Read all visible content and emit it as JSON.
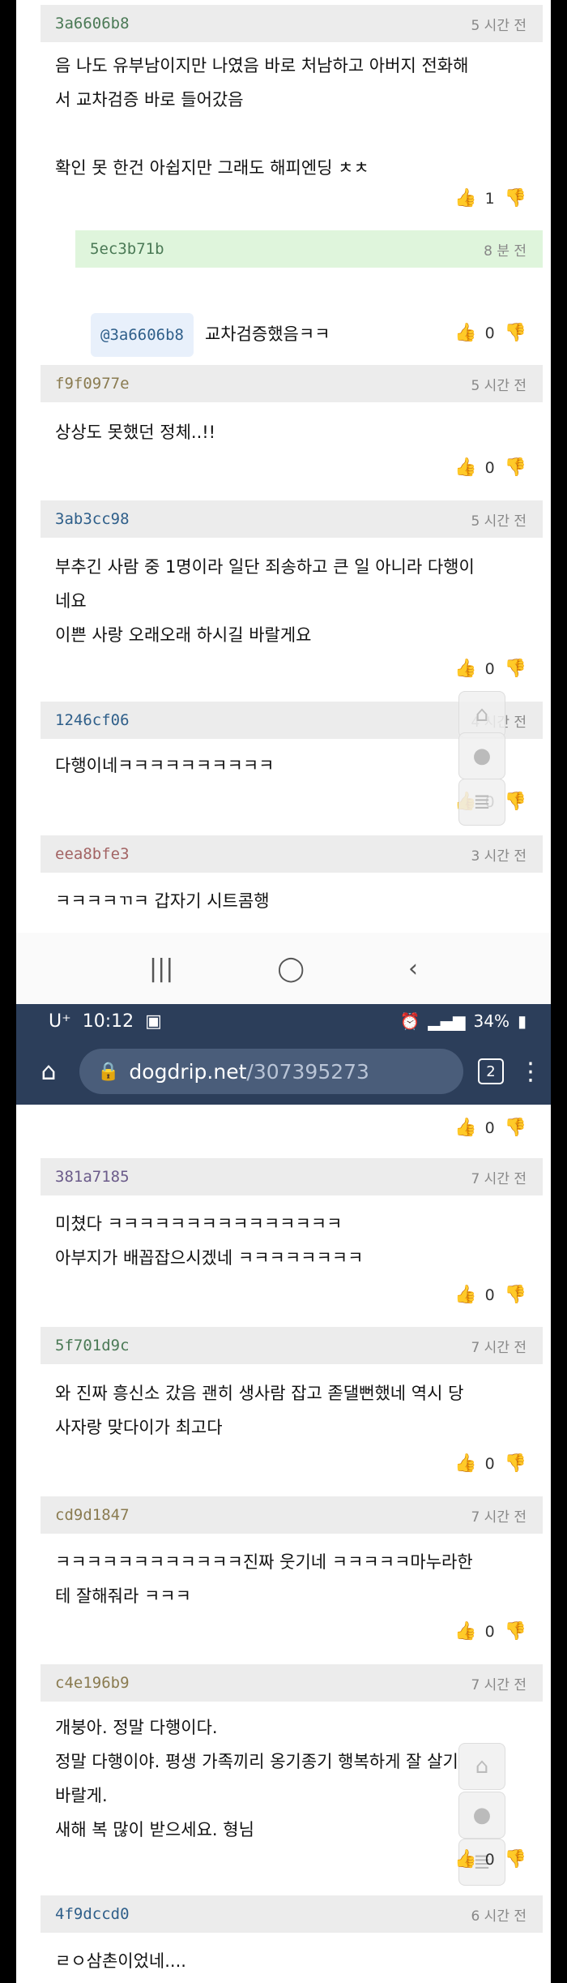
{
  "top_panel": {
    "comments": [
      {
        "id": "3a6606b8",
        "time": "5 시간 전",
        "text": "음 나도 유부남이지만 나였음 바로 처남하고 아버지 전화해\n서 교차검증 바로 들어갔음\n\n확인 못 한건 아쉽지만 그래도 해피엔딩 ㅊㅊ",
        "likes": "1"
      },
      {
        "id": "5ec3b71b",
        "time": "8 분 전",
        "mention": "@3a6606b8",
        "text": "교차검증했음ㅋㅋ",
        "likes": "0"
      },
      {
        "id": "f9f0977e",
        "time": "5 시간 전",
        "text": "상상도 못했던 정체..!!",
        "likes": "0"
      },
      {
        "id": "3ab3cc98",
        "time": "5 시간 전",
        "text": "부추긴 사람 중 1명이라 일단 죄송하고 큰 일 아니라 다행이\n네요\n이쁜 사랑 오래오래 하시길 바랄게요",
        "likes": "0"
      },
      {
        "id": "1246cf06",
        "time": "4 시간 전",
        "text": "다행이네ㅋㅋㅋㅋㅋㅋㅋㅋㅋㅋ",
        "likes": "0"
      },
      {
        "id": "eea8bfe3",
        "time": "3 시간 전",
        "text": "ㅋㅋㅋㅋㄲㅋ 갑자기 시트콤행"
      }
    ]
  },
  "navbar": {
    "recent_icon": "recent-apps-icon",
    "home_icon": "home-circle-icon",
    "back_icon": "back-chevron-icon"
  },
  "statusbar": {
    "carrier": "U⁺",
    "time": "10:12",
    "battery": "34%"
  },
  "urlbar": {
    "domain": "dogdrip.net",
    "path": "/307395273",
    "tab_count": "2"
  },
  "bottom_panel": {
    "top_likes": "0",
    "comments": [
      {
        "id": "381a7185",
        "time": "7 시간 전",
        "text": "미쳤다 ㅋㅋㅋㅋㅋㅋㅋㅋㅋㅋㅋㅋㅋㅋㅋ\n아부지가 배꼽잡으시겠네 ㅋㅋㅋㅋㅋㅋㅋㅋ",
        "likes": "0"
      },
      {
        "id": "5f701d9c",
        "time": "7 시간 전",
        "text": "와 진짜 흥신소 갔음 괜히 생사람 잡고 졷댈뻔했네 역시 당\n사자랑 맞다이가 최고다",
        "likes": "0"
      },
      {
        "id": "cd9d1847",
        "time": "7 시간 전",
        "text": "ㅋㅋㅋㅋㅋㅋㅋㅋㅋㅋㅋㅋ진짜 웃기네 ㅋㅋㅋㅋㅋ마누라한\n테 잘해줘라 ㅋㅋㅋ",
        "likes": "0"
      },
      {
        "id": "c4e196b9",
        "time": "7 시간 전",
        "text": "개붕아. 정말 다행이다.\n정말 다행이야. 평생 가족끼리 옹기종기 행복하게 잘 살기\n바랄게.\n새해 복 많이 받으세요. 형님",
        "likes": "0"
      },
      {
        "id": "4f9dccd0",
        "time": "6 시간 전",
        "text": "ㄹㅇ삼촌이었네...."
      }
    ]
  },
  "colors": {
    "header_bg": "#ececec",
    "reply_header_bg": "#dff5dc",
    "browser_bar": "#2c3e5a"
  }
}
